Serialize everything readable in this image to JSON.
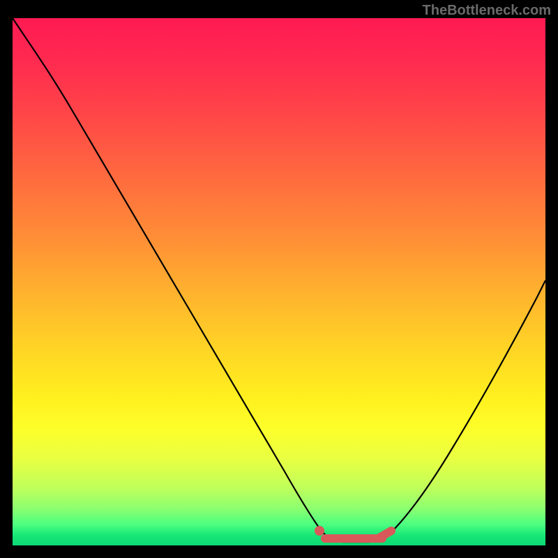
{
  "watermark": "TheBottleneck.com",
  "chart_data": {
    "type": "line",
    "title": "",
    "xlabel": "",
    "ylabel": "",
    "xlim": [
      0,
      100
    ],
    "ylim": [
      0,
      100
    ],
    "grid": false,
    "series": [
      {
        "name": "curve",
        "x": [
          0,
          6,
          12,
          18,
          24,
          30,
          36,
          42,
          48,
          54,
          57.5,
          62,
          66,
          70,
          76,
          82,
          88,
          94,
          100
        ],
        "values": [
          100,
          92,
          83,
          73,
          63,
          53,
          43,
          33,
          22,
          10,
          3,
          1,
          1,
          2,
          8,
          18,
          30,
          43,
          57
        ]
      }
    ],
    "marker": {
      "type": "segment",
      "x_start": 57,
      "x_end": 70,
      "y": 2,
      "color": "#d9585a"
    },
    "background_gradient": {
      "top": "#ff1a52",
      "bottom": "#0dd873"
    }
  }
}
